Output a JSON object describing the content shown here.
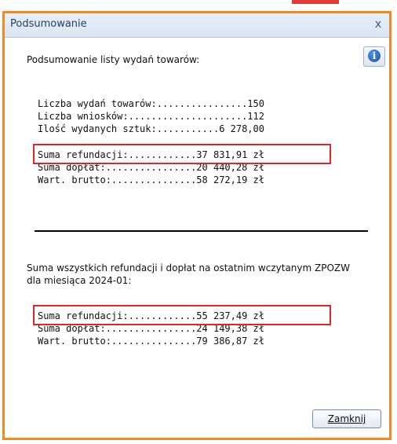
{
  "dialog": {
    "title": "Podsumowanie",
    "close_glyph": "x",
    "intro": "Podsumowanie listy wydań towarów:",
    "info_glyph": "i",
    "section1": {
      "lines": [
        "Liczba wydań towarów:................150",
        "Liczba wniosków:.....................112",
        "Ilość wydanych sztuk:...........6 278,00",
        "Suma refundacji:............37 831,91 zł",
        "Suma dopłat:................20 440,28 zł",
        "Wart. brutto:...............58 272,19 zł"
      ]
    },
    "section2": {
      "heading": "Suma wszystkich refundacji i dopłat na ostatnim wczytanym ZPOZW dla miesiąca 2024-01:",
      "lines": [
        "Suma refundacji:............55 237,49 zł",
        "Suma dopłat:................24 149,38 zł",
        "Wart. brutto:...............79 386,87 zł"
      ]
    },
    "close_button_label": "Zamknij"
  },
  "colors": {
    "window_border": "#f08a24",
    "highlight": "#d62a2a",
    "title_text": "#1f3f73"
  }
}
